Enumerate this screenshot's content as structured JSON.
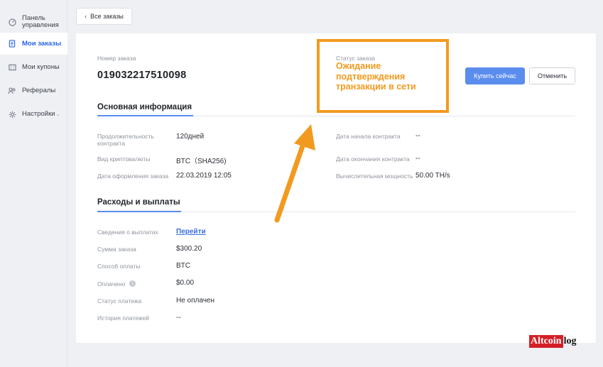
{
  "sidebar": {
    "items": [
      {
        "label": "Панель управления",
        "icon": "dashboard-icon"
      },
      {
        "label": "Мои заказы",
        "icon": "document-icon",
        "active": true
      },
      {
        "label": "Мои купоны",
        "icon": "coupon-icon"
      },
      {
        "label": "Рефералы",
        "icon": "users-icon"
      },
      {
        "label": "Настройки",
        "icon": "gear-icon"
      }
    ]
  },
  "back_button": {
    "label": "Все заказы"
  },
  "order": {
    "number_label": "Номер заказа",
    "number": "019032217510098",
    "status_label": "Статус заказа",
    "status": "Ожидание подтверждения транзакции в сети"
  },
  "actions": {
    "buy": "Купить сейчас",
    "cancel": "Отменить"
  },
  "main_info": {
    "title": "Основная информация",
    "contract_duration_label": "Продолжительность контракта",
    "contract_duration": "120дней",
    "crypto_label": "Вид криптовалюты",
    "crypto": "BTC（SHA256)",
    "order_date_label": "Дата оформления заказа",
    "order_date": "22.03.2019 12:05",
    "start_date_label": "Дата начала контракта",
    "start_date": "--",
    "end_date_label": "Дата окончания контракта",
    "end_date": "--",
    "power_label": "Вычислительная мощность",
    "power": "50.00 TH/s"
  },
  "payments": {
    "title": "Расходы и выплаты",
    "payout_info_label": "Сведения о выплатах",
    "payout_info_link": "Перейти",
    "order_sum_label": "Сумма заказа",
    "order_sum": "$300.20",
    "pay_method_label": "Способ оплаты",
    "pay_method": "BTC",
    "paid_label": "Оплачено",
    "paid": "$0.00",
    "pay_status_label": "Статус платежа",
    "pay_status": "Не оплачен",
    "history_label": "История платежей",
    "history": "--"
  },
  "watermark": {
    "part1": "Altcoin",
    "part2": "log"
  },
  "colors": {
    "accent": "#5b8def",
    "highlight": "#f29a1f",
    "brand_red": "#d51f26"
  }
}
